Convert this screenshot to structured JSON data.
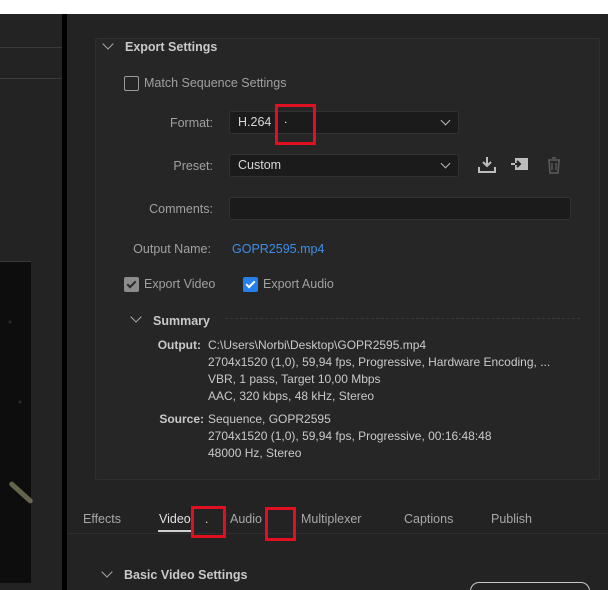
{
  "export_settings": {
    "title": "Export Settings",
    "match_sequence_label": "Match Sequence Settings",
    "format": {
      "label": "Format:",
      "value": "H.264",
      "marker": "."
    },
    "preset": {
      "label": "Preset:",
      "value": "Custom"
    },
    "comments": {
      "label": "Comments:",
      "value": ""
    },
    "output_name": {
      "label": "Output Name:",
      "value": "GOPR2595.mp4"
    },
    "export_video_label": "Export Video",
    "export_audio_label": "Export Audio",
    "export_video_checked": true,
    "export_audio_checked": true,
    "match_sequence_checked": false
  },
  "summary": {
    "title": "Summary",
    "output_label": "Output:",
    "output_lines": [
      "C:\\Users\\Norbi\\Desktop\\GOPR2595.mp4",
      "2704x1520 (1,0), 59,94 fps, Progressive, Hardware Encoding, ...",
      "VBR, 1 pass, Target 10,00 Mbps",
      "AAC, 320 kbps, 48 kHz, Stereo"
    ],
    "source_label": "Source:",
    "source_lines": [
      "Sequence, GOPR2595",
      "2704x1520 (1,0), 59,94 fps, Progressive, 00:16:48:48",
      "48000 Hz, Stereo"
    ]
  },
  "tabs": {
    "effects": "Effects",
    "video": "Video",
    "video_marker": ".",
    "audio": "Audio",
    "multiplexer": "Multiplexer",
    "captions": "Captions",
    "publish": "Publish",
    "active": "Video"
  },
  "basic_video": {
    "title": "Basic Video Settings"
  },
  "icons": {
    "save_preset": "download-icon",
    "import_preset": "import-icon",
    "delete_preset": "trash-icon"
  },
  "colors": {
    "accent_blue": "#2680eb",
    "link_blue": "#3d8ee8",
    "highlight_red": "#e01020",
    "panel_bg": "#232323"
  }
}
